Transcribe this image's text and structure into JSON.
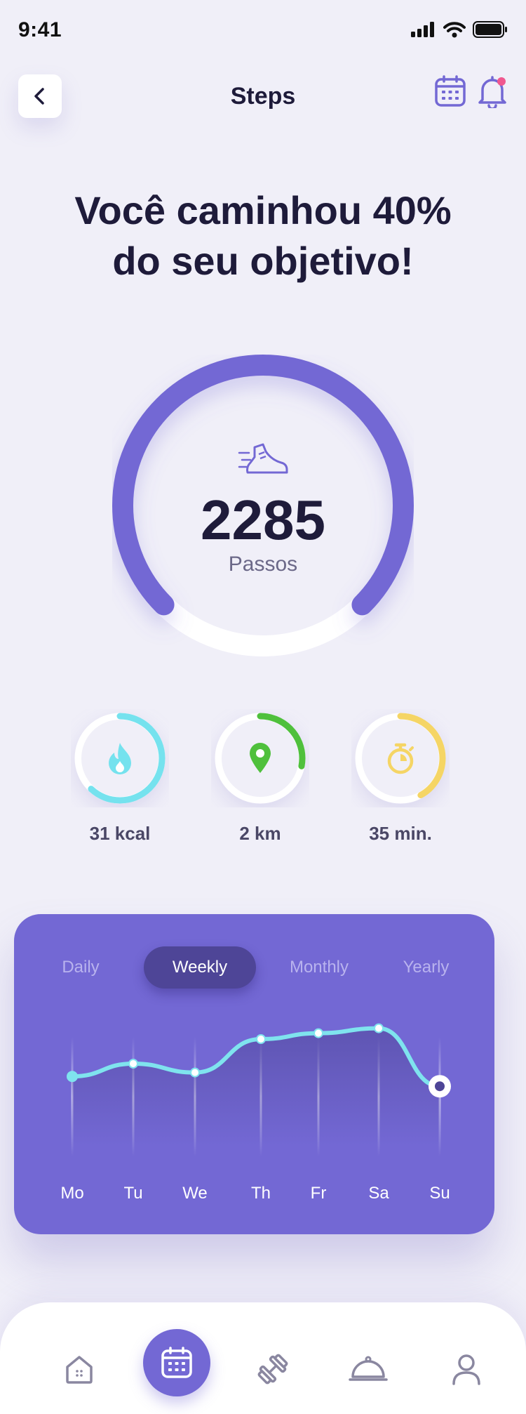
{
  "status_bar": {
    "time": "9:41"
  },
  "header": {
    "title": "Steps"
  },
  "headline": "Você caminhou 40% do seu objetivo!",
  "progress": {
    "percent": 40,
    "steps": "2285",
    "steps_label": "Passos"
  },
  "stats": [
    {
      "label": "31 kcal",
      "icon": "flame-icon",
      "color": "#75e2ee",
      "fraction": 0.62
    },
    {
      "label": "2 km",
      "icon": "location-pin-icon",
      "color": "#4fc03c",
      "fraction": 0.28
    },
    {
      "label": "35 min.",
      "icon": "stopwatch-icon",
      "color": "#f5d565",
      "fraction": 0.42
    }
  ],
  "colors": {
    "accent": "#7368d4",
    "chart_line": "#7fe3ee",
    "background": "#f0eff8"
  },
  "chart": {
    "tabs": [
      "Daily",
      "Weekly",
      "Monthly",
      "Yearly"
    ],
    "active_tab": "Weekly"
  },
  "chart_data": {
    "type": "line",
    "categories": [
      "Mo",
      "Tu",
      "We",
      "Th",
      "Fr",
      "Sa",
      "Su"
    ],
    "series": [
      {
        "values": [
          42,
          55,
          46,
          80,
          86,
          91,
          32
        ]
      }
    ],
    "ylim": [
      0,
      100
    ],
    "grid": false,
    "highlight": "Su"
  },
  "bottom_nav": {
    "items": [
      "home-icon",
      "calendar-icon",
      "dumbbell-icon",
      "food-cloche-icon",
      "user-icon"
    ],
    "active": "calendar-icon"
  }
}
